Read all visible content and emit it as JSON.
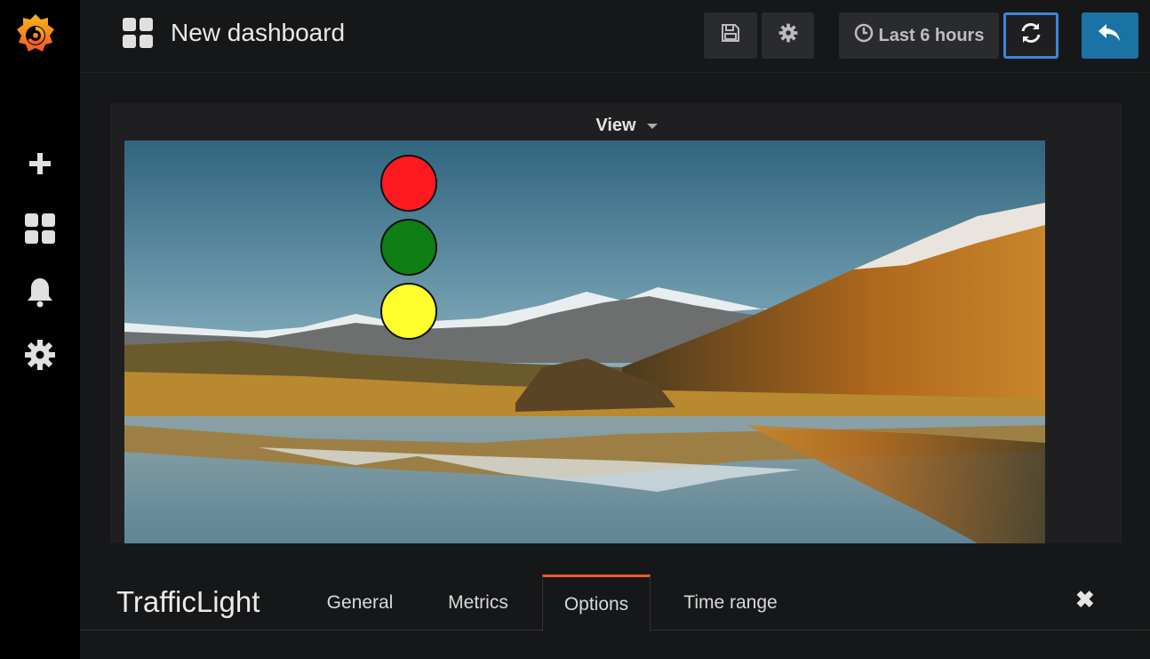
{
  "sidebar": {
    "items": [
      {
        "icon": "plus-icon"
      },
      {
        "icon": "dashboards-icon"
      },
      {
        "icon": "bell-icon"
      },
      {
        "icon": "gear-icon"
      }
    ]
  },
  "header": {
    "title": "New dashboard",
    "time_range": "Last 6 hours"
  },
  "panel": {
    "title": "View",
    "lights": [
      {
        "color": "#ff1a1f"
      },
      {
        "color": "#0f7e14"
      },
      {
        "color": "#ffff2e"
      }
    ]
  },
  "editor": {
    "title": "TrafficLight",
    "tabs": [
      {
        "label": "General"
      },
      {
        "label": "Metrics"
      },
      {
        "label": "Options"
      },
      {
        "label": "Time range"
      }
    ],
    "active_tab": "Options"
  },
  "colors": {
    "accent": "#f05a28",
    "primary_button": "#1b72a5",
    "focus_border": "#3c87d8"
  }
}
